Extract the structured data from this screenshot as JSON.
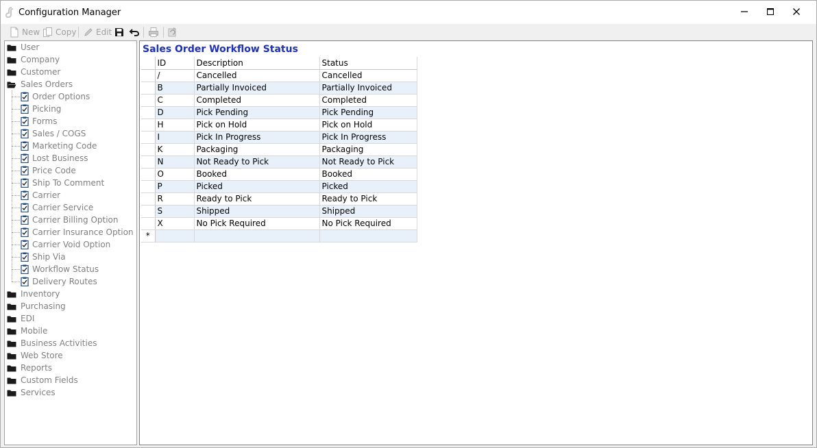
{
  "window": {
    "title": "Configuration Manager",
    "controls": {
      "minimize": "minimize",
      "maximize": "maximize",
      "close": "close"
    }
  },
  "toolbar": {
    "new_label": "New",
    "copy_label": "Copy",
    "edit_label": "Edit"
  },
  "tree": {
    "top_items": [
      {
        "label": "User"
      },
      {
        "label": "Company"
      },
      {
        "label": "Customer"
      },
      {
        "label": "Sales Orders"
      }
    ],
    "sales_children": [
      {
        "label": "Order Options"
      },
      {
        "label": "Picking"
      },
      {
        "label": "Forms"
      },
      {
        "label": "Sales / COGS"
      },
      {
        "label": "Marketing Code"
      },
      {
        "label": "Lost Business"
      },
      {
        "label": "Price Code"
      },
      {
        "label": "Ship To Comment"
      },
      {
        "label": "Carrier"
      },
      {
        "label": "Carrier Service"
      },
      {
        "label": "Carrier Billing Option"
      },
      {
        "label": "Carrier Insurance Option"
      },
      {
        "label": "Carrier Void Option"
      },
      {
        "label": "Ship Via"
      },
      {
        "label": "Workflow Status"
      },
      {
        "label": "Delivery Routes"
      }
    ],
    "bottom_items": [
      {
        "label": "Inventory"
      },
      {
        "label": "Purchasing"
      },
      {
        "label": "EDI"
      },
      {
        "label": "Mobile"
      },
      {
        "label": "Business Activities"
      },
      {
        "label": "Web Store"
      },
      {
        "label": "Reports"
      },
      {
        "label": "Custom Fields"
      },
      {
        "label": "Services"
      }
    ]
  },
  "main": {
    "title": "Sales Order Workflow Status",
    "columns": [
      "ID",
      "Description",
      "Status"
    ],
    "rows": [
      {
        "id": "/",
        "description": "Cancelled",
        "status": "Cancelled"
      },
      {
        "id": "B",
        "description": "Partially Invoiced",
        "status": "Partially Invoiced"
      },
      {
        "id": "C",
        "description": "Completed",
        "status": "Completed"
      },
      {
        "id": "D",
        "description": "Pick Pending",
        "status": "Pick Pending"
      },
      {
        "id": "H",
        "description": "Pick on Hold",
        "status": "Pick on Hold"
      },
      {
        "id": "I",
        "description": "Pick In Progress",
        "status": "Pick In Progress"
      },
      {
        "id": "K",
        "description": "Packaging",
        "status": "Packaging"
      },
      {
        "id": "N",
        "description": "Not Ready to Pick",
        "status": "Not Ready to Pick"
      },
      {
        "id": "O",
        "description": "Booked",
        "status": "Booked"
      },
      {
        "id": "P",
        "description": "Picked",
        "status": "Picked"
      },
      {
        "id": "R",
        "description": "Ready to Pick",
        "status": "Ready to Pick"
      },
      {
        "id": "S",
        "description": "Shipped",
        "status": "Shipped"
      },
      {
        "id": "X",
        "description": "No Pick Required",
        "status": "No Pick Required"
      }
    ],
    "new_row_marker": "*"
  },
  "colors": {
    "title_blue": "#1a2ecc",
    "alt_row": "#e8f1fa",
    "disabled_text": "#808080"
  }
}
